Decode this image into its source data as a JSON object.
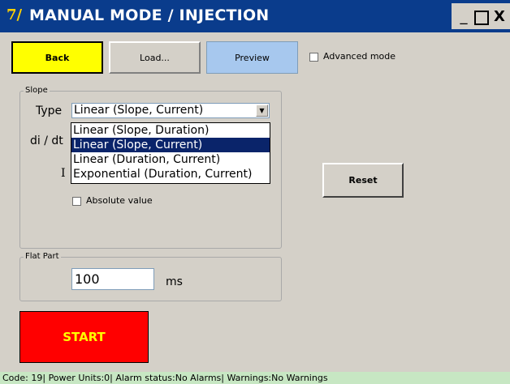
{
  "window": {
    "logo_text": "7/",
    "title": "MANUAL MODE / INJECTION",
    "controls": {
      "minimize": "_",
      "maximize": "□",
      "close": "X"
    }
  },
  "toolbar": {
    "back_label": "Back",
    "load_label": "Load...",
    "preview_label": "Preview",
    "advanced_mode_label": "Advanced mode",
    "advanced_mode_checked": false
  },
  "slope_group": {
    "title": "Slope",
    "type_label": "Type",
    "type_selected": "Linear (Slope, Current)",
    "dropdown_options": [
      "Linear (Slope, Duration)",
      "Linear (Slope, Current)",
      "Linear (Duration, Current)",
      "Exponential (Duration, Current)"
    ],
    "dropdown_highlighted_index": 1,
    "didt_label": "di / dt",
    "i_label": "I",
    "absolute_value_label": "Absolute value",
    "absolute_value_checked": false
  },
  "reset_label": "Reset",
  "flat_part": {
    "title": "Flat Part",
    "value": "100",
    "unit": "ms"
  },
  "start_label": "START",
  "status_bar": "Code: 19| Power Units:0| Alarm status:No Alarms| Warnings:No Warnings",
  "colors": {
    "titlebar": "#0a3c8c",
    "back_button": "#ffff00",
    "preview_button": "#a7c8ee",
    "start_button": "#ff0000",
    "start_text": "#ffff00",
    "status_bar": "#c7e7c3",
    "dropdown_highlight": "#0a246a"
  }
}
